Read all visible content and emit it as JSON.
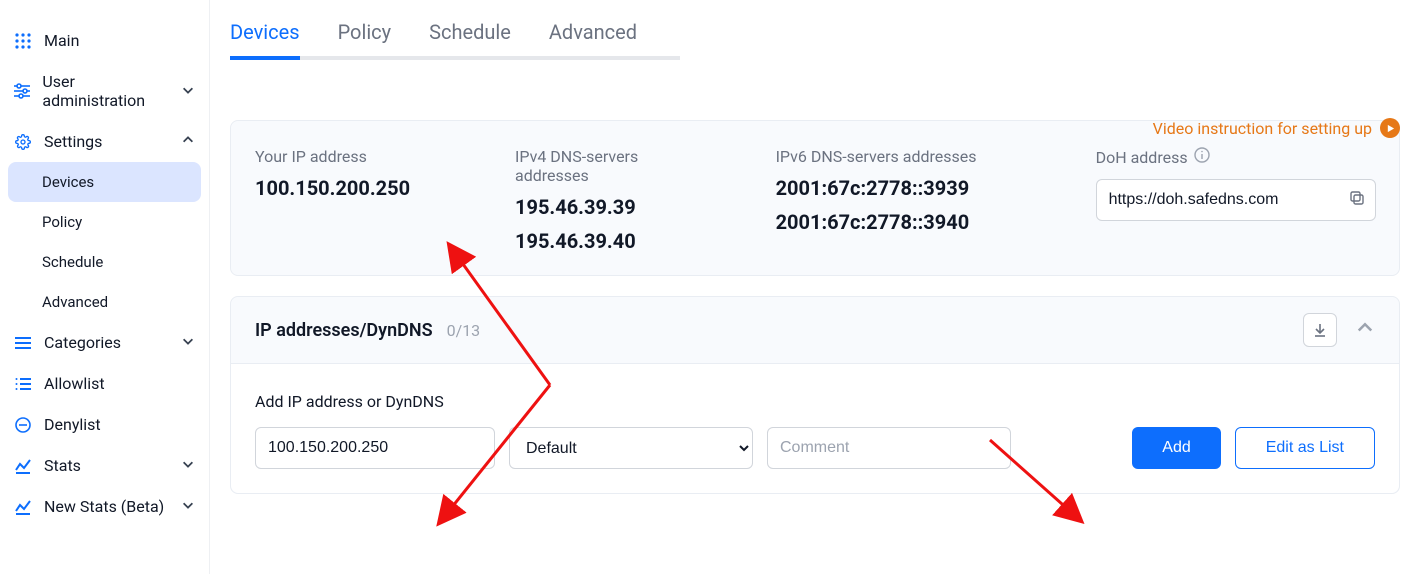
{
  "sidebar": {
    "main_label": "Main",
    "user_admin_label": "User administration",
    "settings_label": "Settings",
    "settings_items": {
      "devices": "Devices",
      "policy": "Policy",
      "schedule": "Schedule",
      "advanced": "Advanced"
    },
    "categories_label": "Categories",
    "allowlist_label": "Allowlist",
    "denylist_label": "Denylist",
    "stats_label": "Stats",
    "newstats_label": "New Stats (Beta)"
  },
  "tabs": {
    "devices": "Devices",
    "policy": "Policy",
    "schedule": "Schedule",
    "advanced": "Advanced"
  },
  "video_link": "Video instruction for setting up",
  "info_panel": {
    "your_ip_label": "Your IP address",
    "your_ip_value": "100.150.200.250",
    "ipv4_label": "IPv4 DNS-servers addresses",
    "ipv4_value1": "195.46.39.39",
    "ipv4_value2": "195.46.39.40",
    "ipv6_label": "IPv6 DNS-servers addresses",
    "ipv6_value1": "2001:67c:2778::3939",
    "ipv6_value2": "2001:67c:2778::3940",
    "doh_label": "DoH address",
    "doh_value": "https://doh.safedns.com"
  },
  "ip_section": {
    "title": "IP addresses/DynDNS",
    "count": "0/13",
    "form_label": "Add IP address or DynDNS",
    "ip_value": "100.150.200.250",
    "policy_value": "Default",
    "comment_placeholder": "Comment",
    "add_btn": "Add",
    "edit_btn": "Edit as List"
  }
}
